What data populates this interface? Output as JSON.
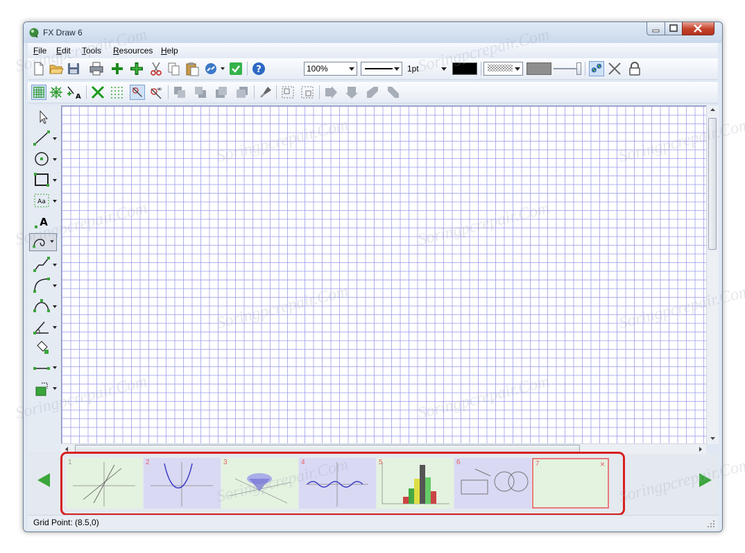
{
  "window": {
    "title": "FX Draw 6"
  },
  "menu": {
    "file": "File",
    "edit": "Edit",
    "tools": "Tools",
    "resources": "Resources",
    "help": "Help"
  },
  "toolbar": {
    "zoom": "100%",
    "line_width": "1pt"
  },
  "pages": [
    {
      "number": "1"
    },
    {
      "number": "2"
    },
    {
      "number": "3"
    },
    {
      "number": "4"
    },
    {
      "number": "5"
    },
    {
      "number": "6"
    },
    {
      "number": "7"
    }
  ],
  "status": {
    "text": "Grid Point: (8.5,0)"
  },
  "watermark": "Soringpcrepair.Com",
  "colors": {
    "grid": "#9a9ae8",
    "accent_red": "#d81f1f",
    "nav_green": "#3aa53a"
  }
}
